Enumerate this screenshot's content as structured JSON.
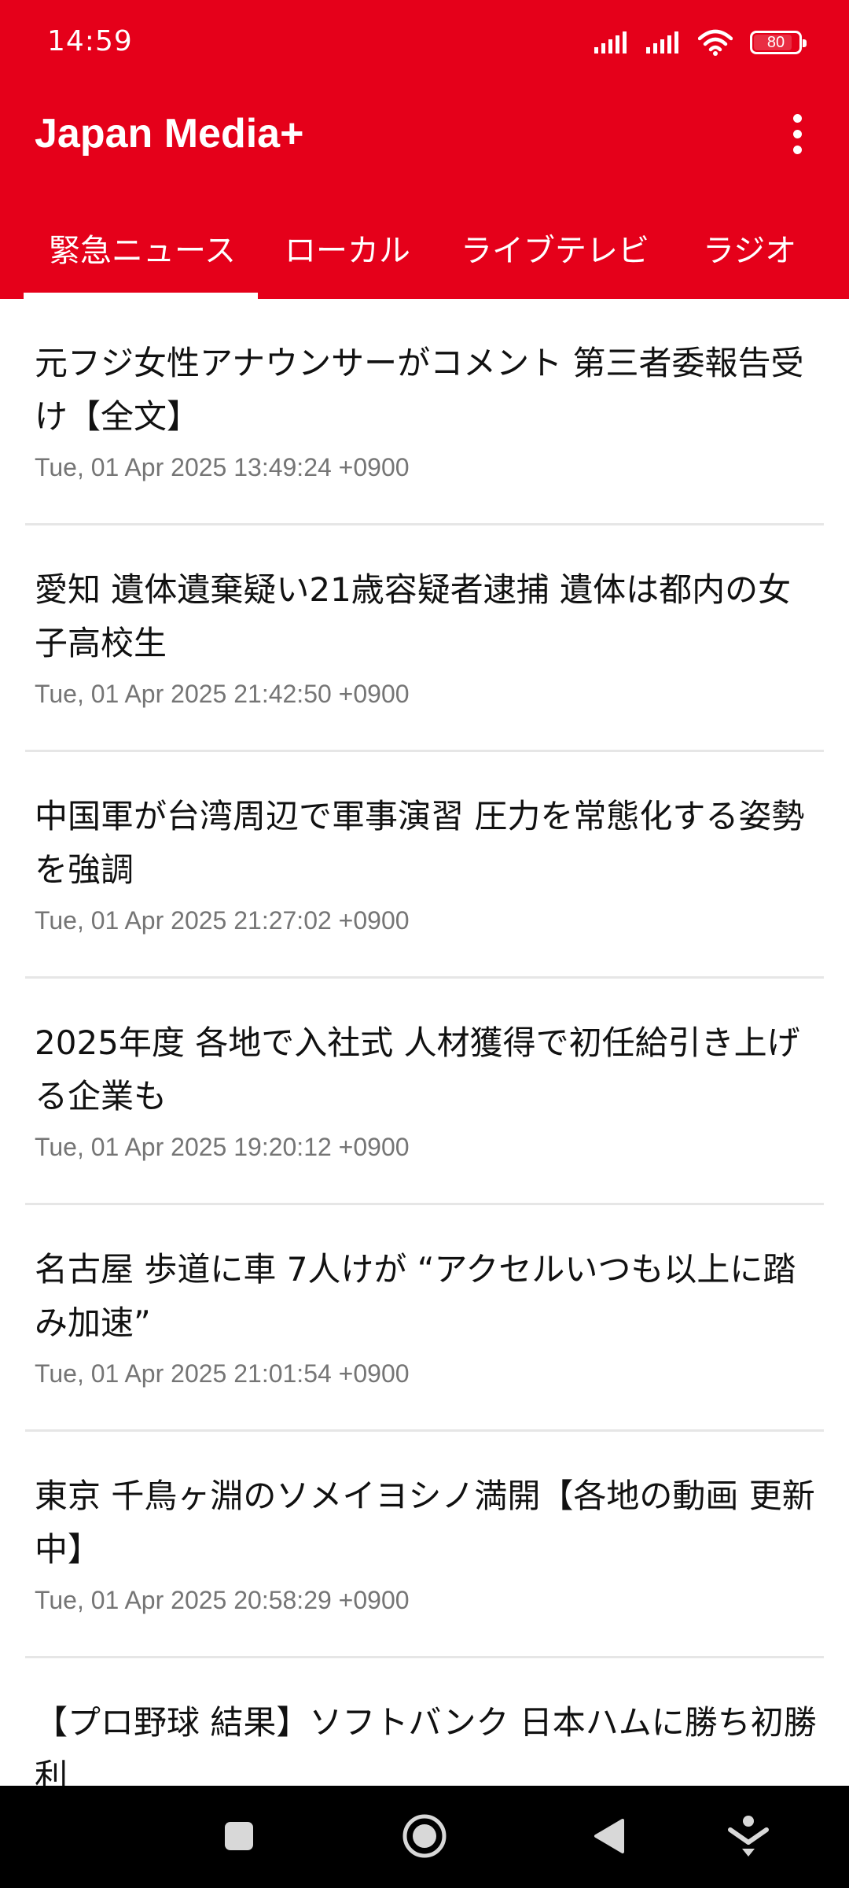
{
  "status_bar": {
    "time": "14:59",
    "battery": "80",
    "icons": [
      "signal-icon",
      "signal-icon",
      "wifi-icon",
      "battery-icon"
    ]
  },
  "app": {
    "title": "Japan Media+",
    "menu_icon": "more-vert-icon",
    "brand_color": "#e5001a"
  },
  "tabs": [
    {
      "label": "緊急ニュース",
      "selected": true
    },
    {
      "label": "ローカル",
      "selected": false
    },
    {
      "label": "ライブテレビ",
      "selected": false
    },
    {
      "label": "ラジオ",
      "selected": false
    }
  ],
  "news": [
    {
      "title": "元フジ女性アナウンサーがコメント 第三者委報告受け【全文】",
      "date": "Tue, 01 Apr 2025 13:49:24 +0900"
    },
    {
      "title": "愛知 遺体遺棄疑い21歳容疑者逮捕 遺体は都内の女子高校生",
      "date": "Tue, 01 Apr 2025 21:42:50 +0900"
    },
    {
      "title": "中国軍が台湾周辺で軍事演習 圧力を常態化する姿勢を強調",
      "date": "Tue, 01 Apr 2025 21:27:02 +0900"
    },
    {
      "title": "2025年度 各地で入社式 人材獲得で初任給引き上げる企業も",
      "date": "Tue, 01 Apr 2025 19:20:12 +0900"
    },
    {
      "title": "名古屋 歩道に車 7人けが “アクセルいつも以上に踏み加速”",
      "date": "Tue, 01 Apr 2025 21:01:54 +0900"
    },
    {
      "title": "東京 千鳥ヶ淵のソメイヨシノ満開【各地の動画 更新中】",
      "date": "Tue, 01 Apr 2025 20:58:29 +0900"
    },
    {
      "title": "【プロ野球 結果】ソフトバンク 日本ハムに勝ち初勝利",
      "date": ""
    }
  ],
  "nav_bar": {
    "icons": [
      "recents-square-icon",
      "home-circle-icon",
      "back-triangle-icon",
      "accessibility-icon"
    ]
  }
}
